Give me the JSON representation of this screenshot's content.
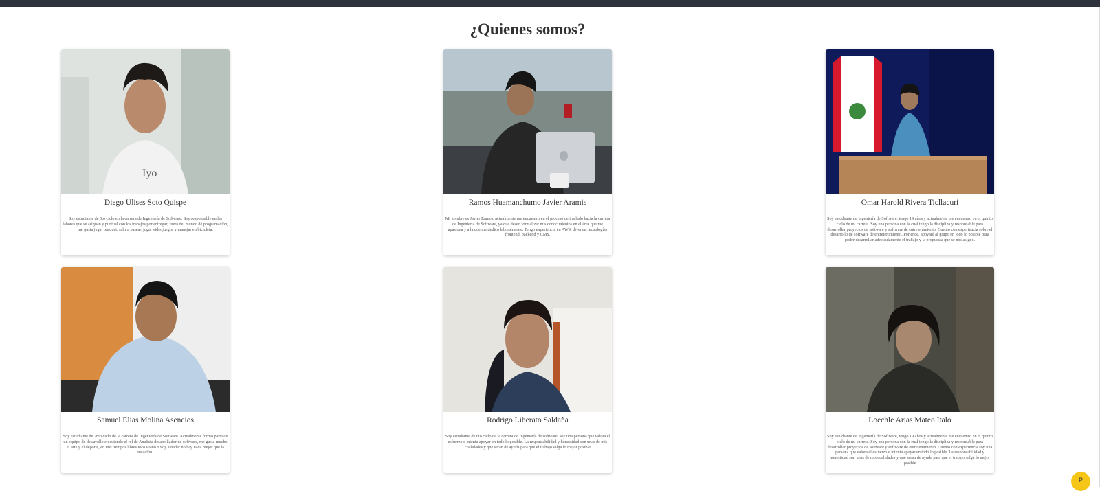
{
  "page": {
    "title": "¿Quienes somos?"
  },
  "members": [
    {
      "name": "Diego Ulises Soto Quispe",
      "bio": "Soy estudiante de 5to ciclo en la carrera de Ingeniería de Software. Soy responsable en las labores que se asignan y puntual con los trabajos por entregar, fuera del mundo de programación, me gusta jugar basquet, salir a pasear, jugar videojuegos y manejar en bicicleta."
    },
    {
      "name": "Ramos Huamanchumo Javier Aramis",
      "bio": "Mi nombre es Javier Ramos, actualmente me encuentro en el proceso de traslado hacia la carrera de Ingeniería de Software, ya que deseo formalizar mis conocimientos en el área que me apasiona y a la que me dedico laboralmente. Tengo experiencia en AWS, diversas tecnologías frontend, backend y CMS."
    },
    {
      "name": "Omar Harold Rivera Ticllacuri",
      "bio": "Soy estudiante de Ingeniería de Software, tengo 19 años y actualmente me encuentro en el quinto ciclo de mi carrera. Soy una persona con la cual tengo la disciplina y responsable para desarrollar proyectos de software y software de entretenimiento. Cuento con experiencia sobre el desarrollo de software de entretenimiento. Por ende, apoyaré al grupo en todo lo posible para poder desarrollar adecuadamente el trabajo y la propuesta que se nos asignó."
    },
    {
      "name": "Samuel Elias Molina Asencios",
      "bio": "Soy estudiante de 7mo ciclo de la carrera de Ingeniería de Software. Actualmente formo parte de un equipo de desarrollo ejecutando el rol de Analista desarrollador de software, me gusta mucho el arte y el deporte, en mis tiempos libres toco Piano o voy a nadar no hay nada mejor que la natación."
    },
    {
      "name": "Rodrigo Liberato Saldaña",
      "bio": "Soy estudiante de 6to ciclo de la carrera de Ingeniería de software, soy una persona que valora el esfuerzo e intenta apoyar en todo lo posible. La responsabilidad y honestidad son unas de mis cualidades y que seran de ayuda para que el trabajo salga lo mejor posible"
    },
    {
      "name": "Loechle Arias Mateo Italo",
      "bio": "Soy estudiante de Ingeniería de Software, tengo 19 años y actualmente me encuentro en el quinto ciclo de mi carrera. Soy una persona con la cual tengo la disciplina y responsable para desarrollar proyectos de software y software de entretenimiento. Cuento con experiencia soy una persona que valora el esfuerzo e intenta apoyar en todo lo posible. La responsabilidad y honestidad son unas de mis cualidades y que seran de ayuda para que el trabajo salga lo mejor posible"
    }
  ],
  "fab": {
    "label": "P"
  },
  "colors": {
    "topbar": "#2e323d",
    "fab": "#f5c518",
    "text": "#333333"
  }
}
